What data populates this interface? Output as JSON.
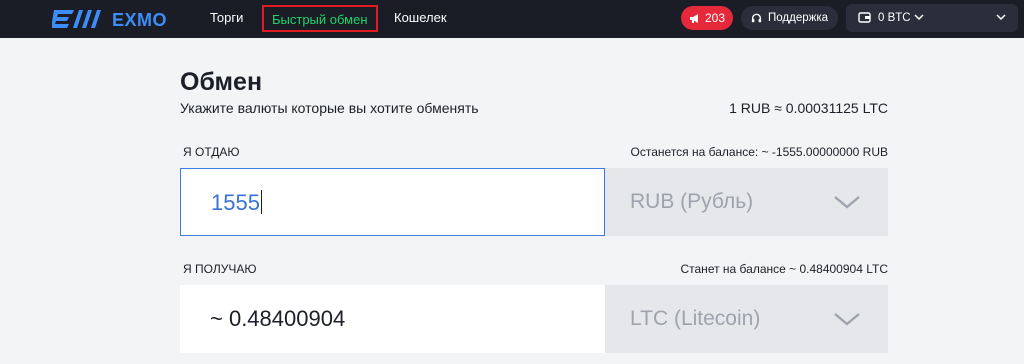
{
  "brand": {
    "name": "EXMO",
    "color": "#3d8cf7"
  },
  "nav": {
    "trade": "Торги",
    "quick_exchange": "Быстрый обмен",
    "wallet": "Кошелек"
  },
  "header": {
    "notifications_count": "203",
    "support": "Поддержка",
    "balance": "0 BTC"
  },
  "main": {
    "title": "Обмен",
    "subtitle": "Укажите валюты которые вы хотите обменять",
    "rate": "1 RUB ≈ 0.00031125 LTC"
  },
  "give": {
    "label": "Я ОТДАЮ",
    "balance_note": "Останется на балансе: ~ -1555.00000000 RUB",
    "amount": "1555",
    "currency": "RUB (Рубль)"
  },
  "receive": {
    "label": "Я ПОЛУЧАЮ",
    "balance_note": "Станет на балансе ~ 0.48400904 LTC",
    "amount": "~ 0.48400904",
    "currency": "LTC (Litecoin)"
  },
  "colors": {
    "topbar": "#1a1d26",
    "active_nav": "#22d36b",
    "highlight_border": "#e11b22",
    "notification": "#e5283a",
    "input_focus": "#3d7be0"
  }
}
